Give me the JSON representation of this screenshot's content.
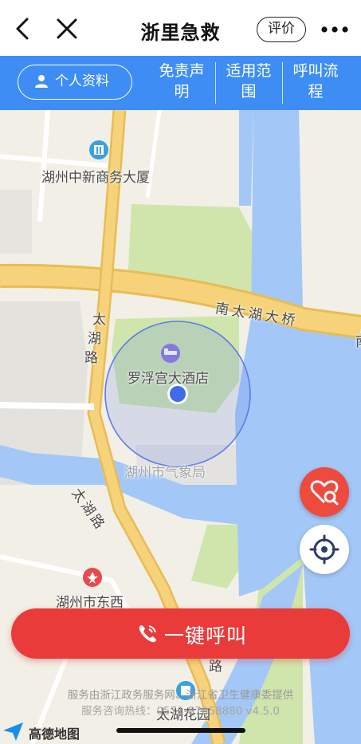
{
  "header": {
    "title": "浙里急救",
    "rate_label": "评价",
    "back_icon": "chevron-left-icon",
    "close_icon": "close-icon",
    "more_icon": "more-dots-icon"
  },
  "nav": {
    "profile_label": "个人资料",
    "profile_icon": "person-icon",
    "items": [
      {
        "line1": "免责声",
        "line2": "明"
      },
      {
        "line1": "适用范",
        "line2": "围"
      },
      {
        "line1": "呼叫流",
        "line2": "程"
      }
    ]
  },
  "map": {
    "labels": {
      "building": "湖州中新商务大厦",
      "bridge": "南太湖大桥",
      "bridge_edge": "南",
      "road_tai": "太",
      "road_hu": "湖",
      "road_lu": "路",
      "hotel": "罗浮宫大酒店",
      "weather": "湖州市气象局",
      "road2": "太湖路",
      "dongxi": "湖州市东西",
      "garden": "太湖花园",
      "road_edge": "路"
    },
    "colors": {
      "land": "#f2efe6",
      "water": "#a3c8f7",
      "green": "#cfe5ac",
      "road": "#f6d37a",
      "accuracy": "#5b7be8"
    }
  },
  "actions": {
    "sos_icon": "heart-search-icon",
    "locate_icon": "crosshair-icon",
    "call_label": "一键呼叫",
    "call_icon": "phone-icon"
  },
  "footer": {
    "line1": "服务由浙江政务服务网、浙江省卫生健康委提供",
    "line2": "服务咨询热线：0571-87058880    v4.5.0",
    "map_provider": "高德地图"
  }
}
